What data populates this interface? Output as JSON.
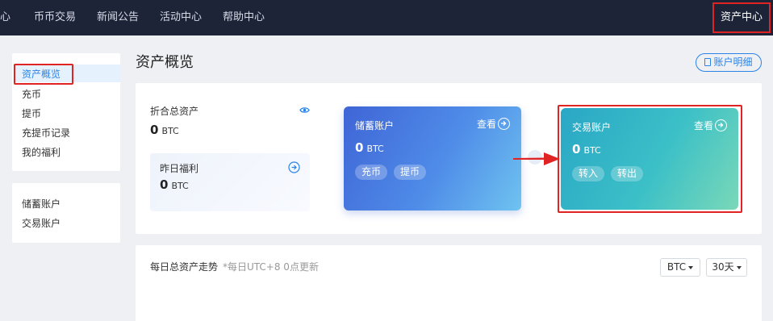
{
  "nav": {
    "items": [
      "心",
      "币币交易",
      "新闻公告",
      "活动中心",
      "帮助中心"
    ],
    "asset_center": "资产中心"
  },
  "sidebar": {
    "group1": [
      "资产概览",
      "充币",
      "提币",
      "充提币记录",
      "我的福利"
    ],
    "group2": [
      "储蓄账户",
      "交易账户"
    ]
  },
  "main": {
    "title": "资产概览",
    "detail_button": "账户明细",
    "summary": {
      "total_label": "折合总资产",
      "total_value": "0",
      "total_unit": "BTC",
      "bonus_label": "昨日福利",
      "bonus_value": "0",
      "bonus_unit": "BTC"
    },
    "savings": {
      "title": "储蓄账户",
      "view": "查看",
      "value": "0",
      "unit": "BTC",
      "btn1": "充币",
      "btn2": "提币"
    },
    "trade": {
      "title": "交易账户",
      "view": "查看",
      "value": "0",
      "unit": "BTC",
      "btn1": "转入",
      "btn2": "转出"
    },
    "trend": {
      "title": "每日总资产走势",
      "note": "*每日UTC+8 0点更新",
      "currency": "BTC",
      "range": "30天"
    }
  },
  "colors": {
    "nav_bg": "#1d2438",
    "accent": "#2a84e8",
    "annotation_red": "#e02424"
  }
}
